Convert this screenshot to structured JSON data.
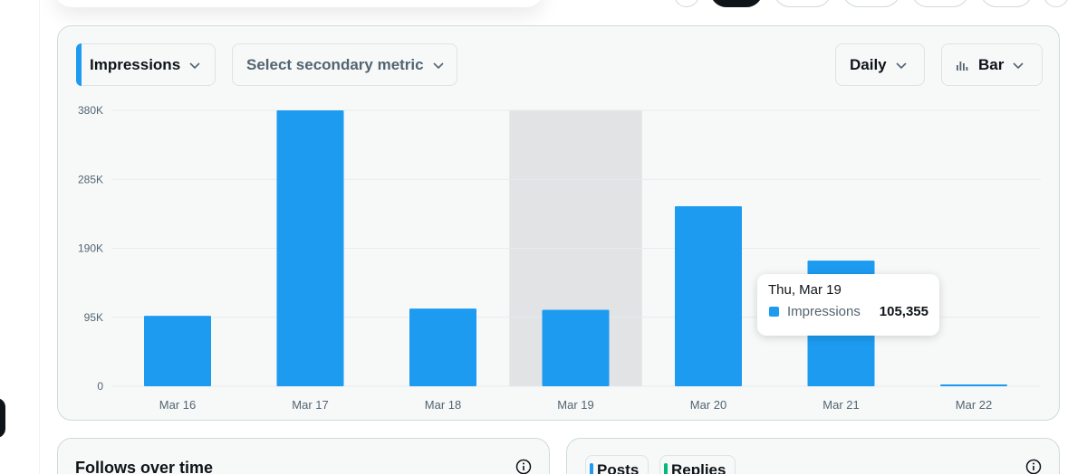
{
  "colors": {
    "accent": "#1d9bf0",
    "bar": "#1d9bf0",
    "hover_band": "#e1e3e5",
    "grid": "#e6ecef",
    "text_muted": "#536471",
    "replies_mark": "#00ba7c"
  },
  "controls": {
    "primary_metric": "Impressions",
    "secondary_metric_placeholder": "Select secondary metric",
    "interval": "Daily",
    "chart_type": "Bar",
    "chart_type_icon": "bar-chart-icon",
    "dropdown_icon": "chevron-down-icon"
  },
  "chart_data": {
    "type": "bar",
    "categories": [
      "Mar 16",
      "Mar 17",
      "Mar 18",
      "Mar 19",
      "Mar 20",
      "Mar 21",
      "Mar 22"
    ],
    "series": [
      {
        "name": "Impressions",
        "values": [
          97000,
          380000,
          107000,
          105355,
          248000,
          173000,
          2000
        ]
      }
    ],
    "ylim": [
      0,
      380000
    ],
    "yticks": [
      0,
      95000,
      190000,
      285000,
      380000
    ],
    "ytick_labels": [
      "0",
      "95K",
      "190K",
      "285K",
      "380K"
    ],
    "highlighted_category": "Mar 19",
    "grid": true
  },
  "tooltip": {
    "date": "Thu, Mar 19",
    "series_name": "Impressions",
    "value": "105,355"
  },
  "follows_card": {
    "title": "Follows over time",
    "info_icon": "info-icon"
  },
  "posts_card": {
    "tabs": [
      "Posts",
      "Replies"
    ],
    "info_icon": "info-icon"
  }
}
